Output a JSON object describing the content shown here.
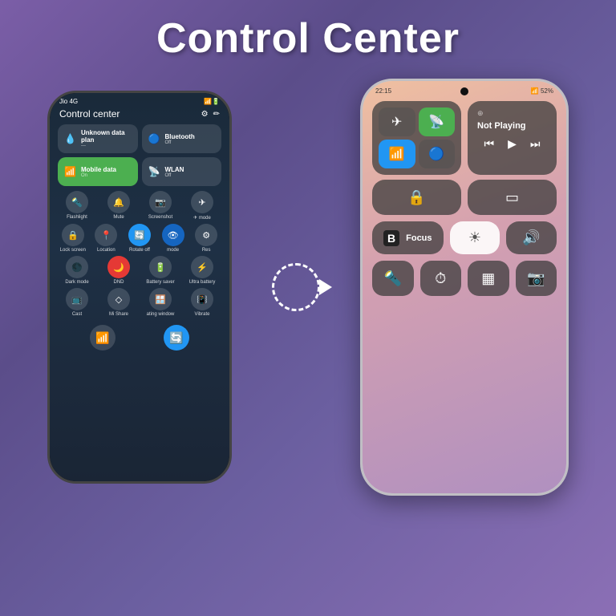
{
  "title": "Control Center",
  "left_phone": {
    "status": {
      "carrier": "Jio 4G",
      "icons": "📶🔋"
    },
    "header": "Control center",
    "tiles": [
      {
        "icon": "💧",
        "name": "Unknown data plan",
        "sub": "---"
      },
      {
        "icon": "🔵",
        "name": "Bluetooth",
        "sub": "Off",
        "type": "normal"
      },
      {
        "icon": "📶",
        "name": "Mobile data",
        "sub": "On",
        "type": "green"
      },
      {
        "icon": "📡",
        "name": "WLAN",
        "sub": "Off",
        "type": "normal"
      }
    ],
    "icon_rows": [
      [
        {
          "icon": "🔦",
          "label": "Flashlight"
        },
        {
          "icon": "🔔",
          "label": "Mute"
        },
        {
          "icon": "📷",
          "label": "Screenshot"
        },
        {
          "icon": "✈",
          "label": "✈ mode"
        }
      ],
      [
        {
          "icon": "🔒",
          "label": "Lock screen"
        },
        {
          "icon": "📍",
          "label": "Location"
        },
        {
          "icon": "🔄",
          "label": "Rotate off",
          "blue": true
        },
        {
          "icon": "👁",
          "label": "mode"
        },
        {
          "icon": "⚙",
          "label": "Res"
        }
      ],
      [
        {
          "icon": "🌑",
          "label": "Dark mode"
        },
        {
          "icon": "🌙",
          "label": "DND",
          "red": true
        },
        {
          "icon": "🔋",
          "label": "Battery saver"
        },
        {
          "icon": "⚡",
          "label": "Ultra battery"
        }
      ],
      [
        {
          "icon": "📺",
          "label": "Cast"
        },
        {
          "icon": "◇",
          "label": "Mi Share"
        },
        {
          "icon": "🪟",
          "label": "ating window"
        },
        {
          "icon": "📳",
          "label": "Vibrate"
        }
      ]
    ],
    "bottom": [
      {
        "icon": "📶",
        "type": "normal"
      },
      {
        "icon": "🔄",
        "type": "blue"
      }
    ]
  },
  "right_phone": {
    "status_time": "22:15",
    "battery": "52%",
    "toggle_buttons": [
      {
        "icon": "✈",
        "label": "airplane",
        "active": false
      },
      {
        "icon": "📡",
        "label": "signal",
        "active": true,
        "color": "green"
      },
      {
        "icon": "📶",
        "label": "wifi",
        "active": true,
        "color": "blue"
      },
      {
        "icon": "🔵",
        "label": "bluetooth",
        "active": false
      }
    ],
    "not_playing": {
      "header_icon": "🎵",
      "label": "Not Playing",
      "controls": [
        "⏮",
        "▶",
        "⏭"
      ]
    },
    "second_row": [
      {
        "icon": "🔒",
        "label": "screen-lock"
      },
      {
        "icon": "▭",
        "label": "screen-mirror"
      },
      {
        "icon": "",
        "label": "empty1"
      },
      {
        "icon": "",
        "label": "empty2"
      }
    ],
    "focus_row": {
      "focus": {
        "icon": "B",
        "label": "Focus"
      },
      "brightness": {
        "icon": "☀",
        "label": "brightness"
      },
      "volume": {
        "icon": "🔊",
        "label": "volume"
      }
    },
    "bottom_row": [
      {
        "icon": "🔦",
        "label": "flashlight"
      },
      {
        "icon": "⏱",
        "label": "timer"
      },
      {
        "icon": "▦",
        "label": "calculator"
      },
      {
        "icon": "📷",
        "label": "camera"
      }
    ]
  },
  "arrow": {
    "label": "arrow-right"
  }
}
